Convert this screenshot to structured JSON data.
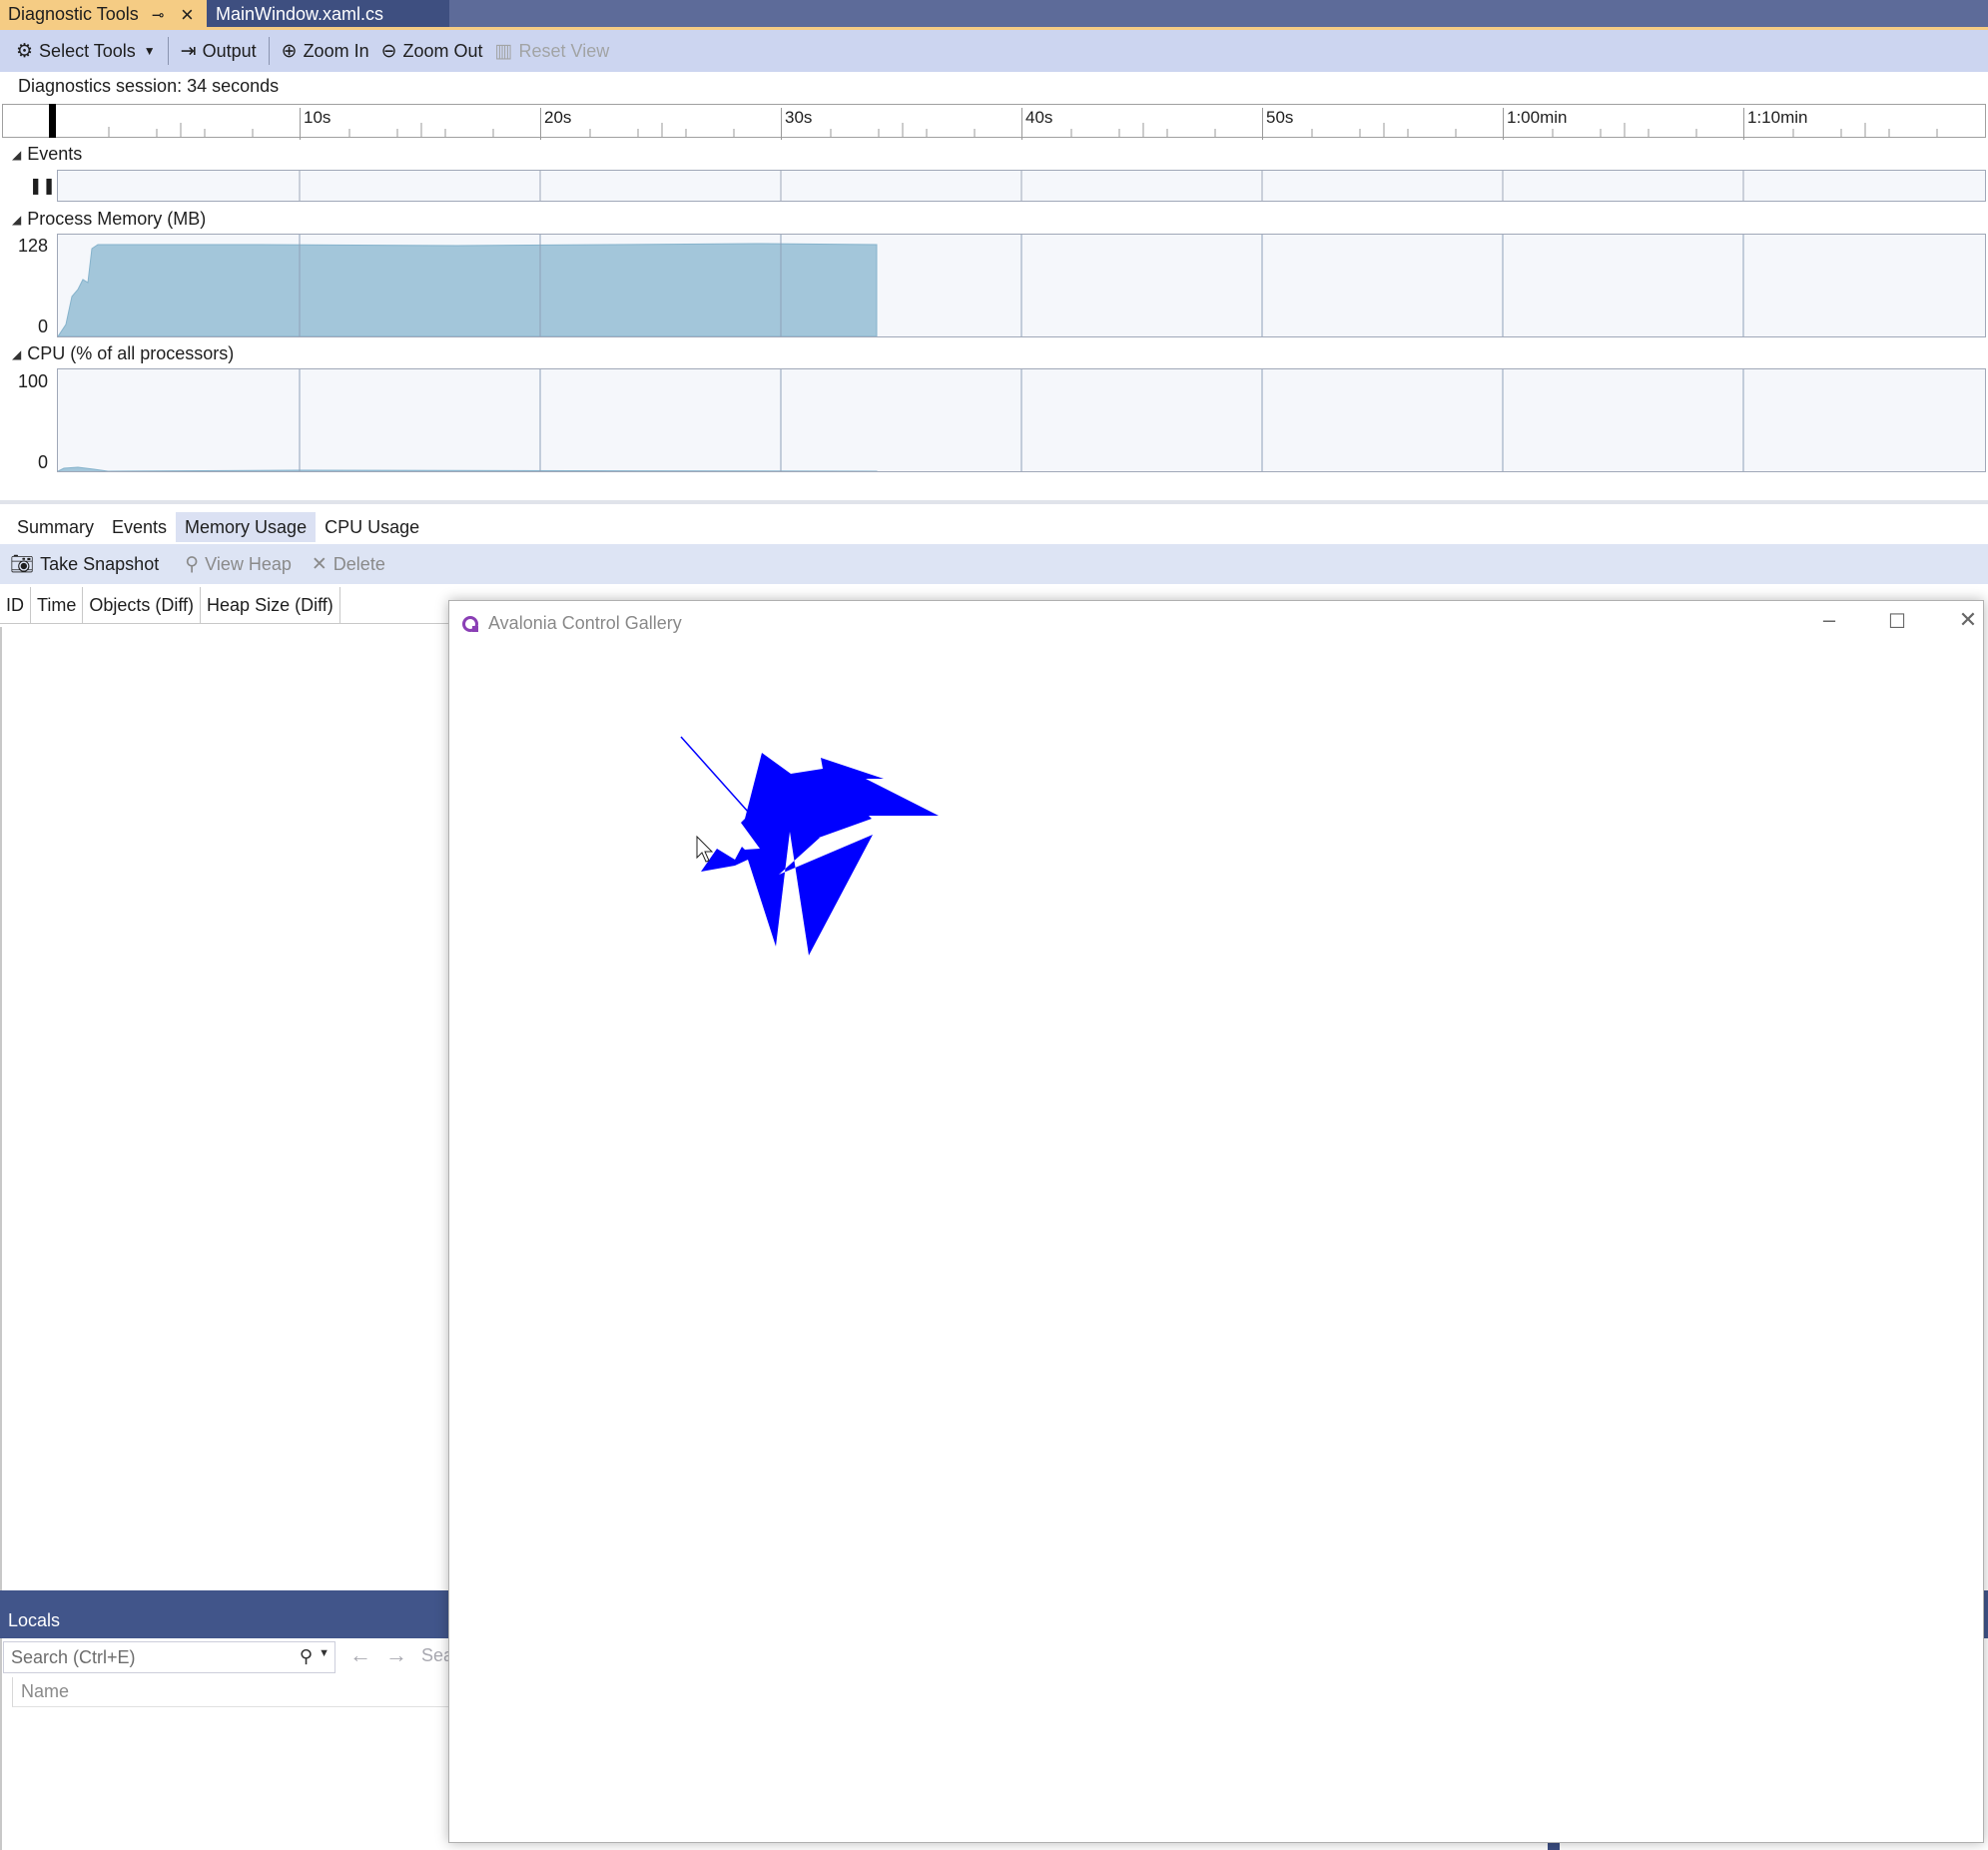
{
  "tabs": {
    "active_label": "Diagnostic Tools",
    "inactive_label": "MainWindow.xaml.cs"
  },
  "toolbar": {
    "select_tools": "Select Tools",
    "output": "Output",
    "zoom_in": "Zoom In",
    "zoom_out": "Zoom Out",
    "reset_view": "Reset View"
  },
  "session": {
    "label": "Diagnostics session: 34 seconds"
  },
  "ruler": {
    "ticks": [
      "10s",
      "20s",
      "30s",
      "40s",
      "50s",
      "1:00min",
      "1:10min"
    ]
  },
  "events": {
    "title": "Events"
  },
  "memory": {
    "title": "Process Memory (MB)",
    "y_max": "128",
    "y_min": "0"
  },
  "cpu": {
    "title": "CPU (% of all processors)",
    "y_max": "100",
    "y_min": "0"
  },
  "bottom_tabs": [
    "Summary",
    "Events",
    "Memory Usage",
    "CPU Usage"
  ],
  "bottom_toolbar": {
    "take_snapshot": "Take Snapshot",
    "view_heap": "View Heap",
    "delete": "Delete"
  },
  "grid_columns": [
    "ID",
    "Time",
    "Objects (Diff)",
    "Heap Size (Diff)"
  ],
  "locals": {
    "title": "Locals",
    "search_placeholder": "Search (Ctrl+E)",
    "search_depth_fragment": "Sear",
    "name_header": "Name"
  },
  "avalonia": {
    "title": "Avalonia Control Gallery",
    "shape_color": "#0000ff"
  },
  "colors": {
    "tab_active": "#f5cc84",
    "toolbar": "#ccd5f0",
    "memory_fill": "#a3c6da"
  }
}
